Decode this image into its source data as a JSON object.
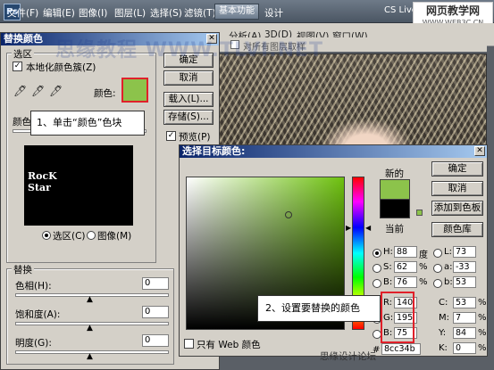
{
  "menubar": {
    "items": [
      "文件(F)",
      "编辑(E)",
      "图像(I)",
      "图层(L)",
      "选择(S)",
      "滤镜(T)",
      "分析(A)",
      "3D(D)",
      "视图(V)",
      "窗口(W)"
    ],
    "workspace": "基本功能",
    "design_tab": "设计",
    "cs_live": "CS Live"
  },
  "site_logo": {
    "line1": "网页教学网",
    "line2": "WWW.WEB3C.CN"
  },
  "options_bar": {
    "checkbox_label": "对所有图层取样"
  },
  "site_watermark": "思缘教程 WWW.TLVI.NET",
  "replace_color": {
    "title": "替换颜色",
    "selection_group": "选区",
    "localized_label": "本地化颜色簇(Z)",
    "color_label": "颜色:",
    "fuzziness_label": "颜色容差(F):",
    "ok": "确定",
    "cancel": "取消",
    "load": "载入(L)...",
    "save": "存储(S)...",
    "preview": "预览(P)",
    "preview_text_1": "RocK",
    "preview_text_2": "Star",
    "radio_selection": "选区(C)",
    "radio_image": "图像(M)",
    "replace_group": "替换",
    "hue_label": "色相(H):",
    "hue_value": "0",
    "saturation_label": "饱和度(A):",
    "saturation_value": "0",
    "lightness_label": "明度(G):",
    "lightness_value": "0",
    "swatch_color": "#8cc34b"
  },
  "callouts": {
    "step1": "1、单击“颜色”色块",
    "step2": "2、设置要替换的颜色"
  },
  "color_picker": {
    "title": "选择目标颜色:",
    "ok": "确定",
    "cancel": "取消",
    "add_to_swatches": "添加到色板",
    "color_libraries": "颜色库",
    "new_label": "新的",
    "current_label": "当前",
    "web_only": "只有 Web 颜色",
    "new_color": "#8cc34b",
    "current_color": "#000000",
    "H": "88",
    "H_unit": "度",
    "S": "62",
    "S_unit": "%",
    "B": "76",
    "B_unit": "%",
    "R": "140",
    "G": "195",
    "Bv": "75",
    "L": "73",
    "a": "-33",
    "b": "53",
    "C": "53",
    "C_unit": "%",
    "M": "7",
    "M_unit": "%",
    "Y": "84",
    "Y_unit": "%",
    "K": "0",
    "K_unit": "%",
    "hex": "8cc34b"
  },
  "watermark": "思缘设计论坛"
}
